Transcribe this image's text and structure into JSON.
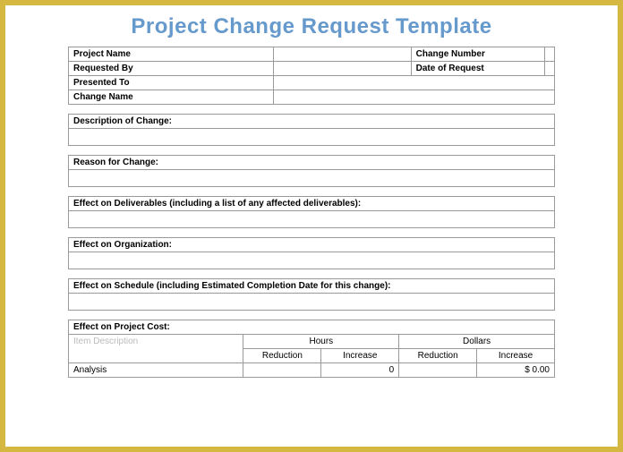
{
  "title": "Project Change Request Template",
  "info": {
    "projectName": "Project Name",
    "changeNumber": "Change Number",
    "requestedBy": "Requested By",
    "dateOfRequest": "Date of Request",
    "presentedTo": "Presented To",
    "changeName": "Change Name"
  },
  "sections": {
    "description": "Description of Change:",
    "reason": "Reason for Change:",
    "deliverables": "Effect on Deliverables  (including a list of any affected deliverables):",
    "organization": "Effect on Organization:",
    "schedule": "Effect on Schedule (including Estimated Completion Date for this change):",
    "cost": "Effect on Project Cost:"
  },
  "costTable": {
    "itemDescription": "Item Description",
    "hours": "Hours",
    "dollars": "Dollars",
    "reduction": "Reduction",
    "increase": "Increase",
    "analysis": "Analysis",
    "hoursIncreaseVal": "0",
    "dollarsIncreaseVal": "$  0.00"
  }
}
